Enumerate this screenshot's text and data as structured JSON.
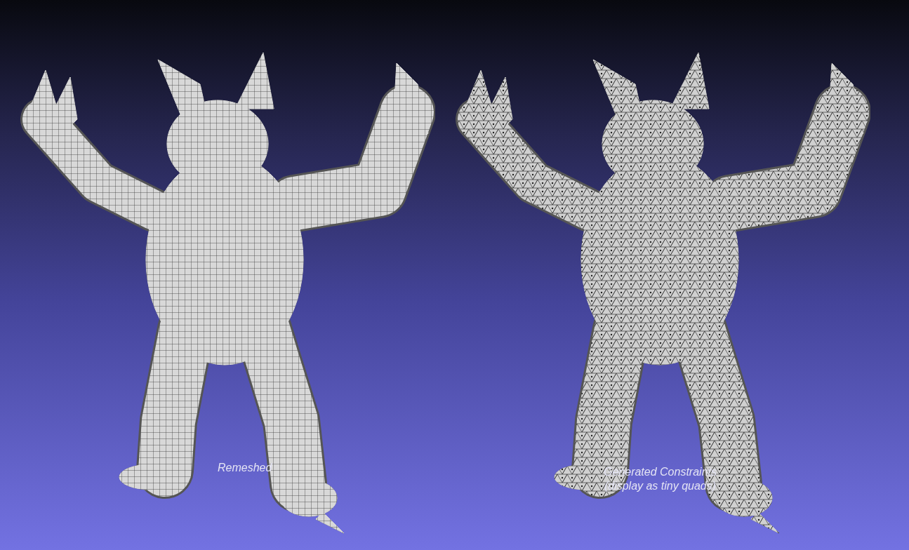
{
  "viewport": {
    "models": [
      {
        "kind": "quad",
        "label_lines": [
          "Remeshed"
        ]
      },
      {
        "kind": "triangle",
        "label_lines": [
          "Generated Constraints",
          "(display as tiny quads)"
        ]
      }
    ]
  }
}
